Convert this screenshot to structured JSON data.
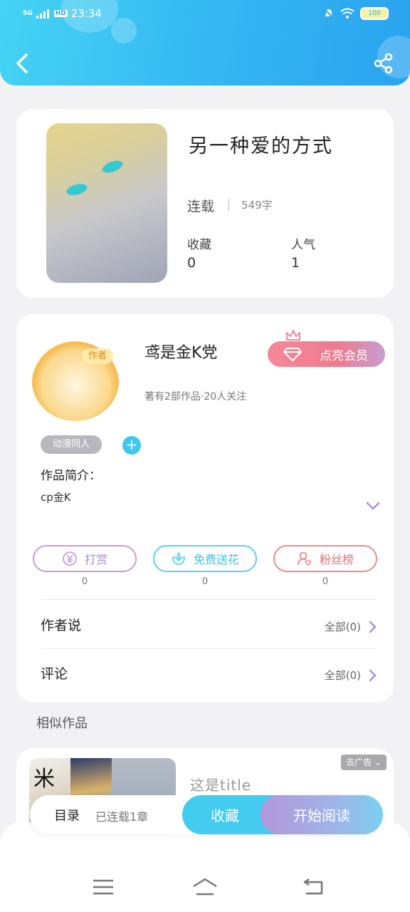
{
  "status_bar": {
    "network": "5G",
    "hd": "HD",
    "time": "23:34",
    "battery": "100"
  },
  "header": {
    "back_icon": "chevron-left-icon",
    "share_icon": "share-icon",
    "background": "#35b8f2"
  },
  "book": {
    "title": "另一种爱的方式",
    "status": "连载",
    "word_count": "549字",
    "stats": [
      {
        "label": "收藏",
        "value": "0"
      },
      {
        "label": "人气",
        "value": "1"
      }
    ]
  },
  "author": {
    "name": "鸢是金K党",
    "badge": "作者",
    "meta": "著有2部作品·20人关注",
    "vip_label": "点亮会员",
    "tag": "动漫同人",
    "tag_add": "+",
    "intro_label": "作品简介：",
    "intro_text": "cp金K",
    "actions": [
      {
        "label": "打赏",
        "count": "0",
        "icon": "yen-icon"
      },
      {
        "label": "免费送花",
        "count": "0",
        "icon": "flower-icon"
      },
      {
        "label": "粉丝榜",
        "count": "0",
        "icon": "fan-user-icon"
      }
    ],
    "rows": [
      {
        "label": "作者说",
        "right": "全部(0)"
      },
      {
        "label": "评论",
        "right": "全部(0)"
      }
    ]
  },
  "similar": {
    "section_title": "相似作品",
    "item": {
      "thumb_char": "米",
      "name": "这是title",
      "ad_tag": "去广告 ⌄"
    }
  },
  "bottom_bar": {
    "toc_label": "目录",
    "toc_info": "已连载1章",
    "collect_label": "收藏",
    "read_label": "开始阅读"
  },
  "colors": {
    "accent": "#43ccef",
    "vip": "#ee7b8f",
    "reward": "#b187d6",
    "flower": "#3cc0e6",
    "fans": "#e07373"
  }
}
